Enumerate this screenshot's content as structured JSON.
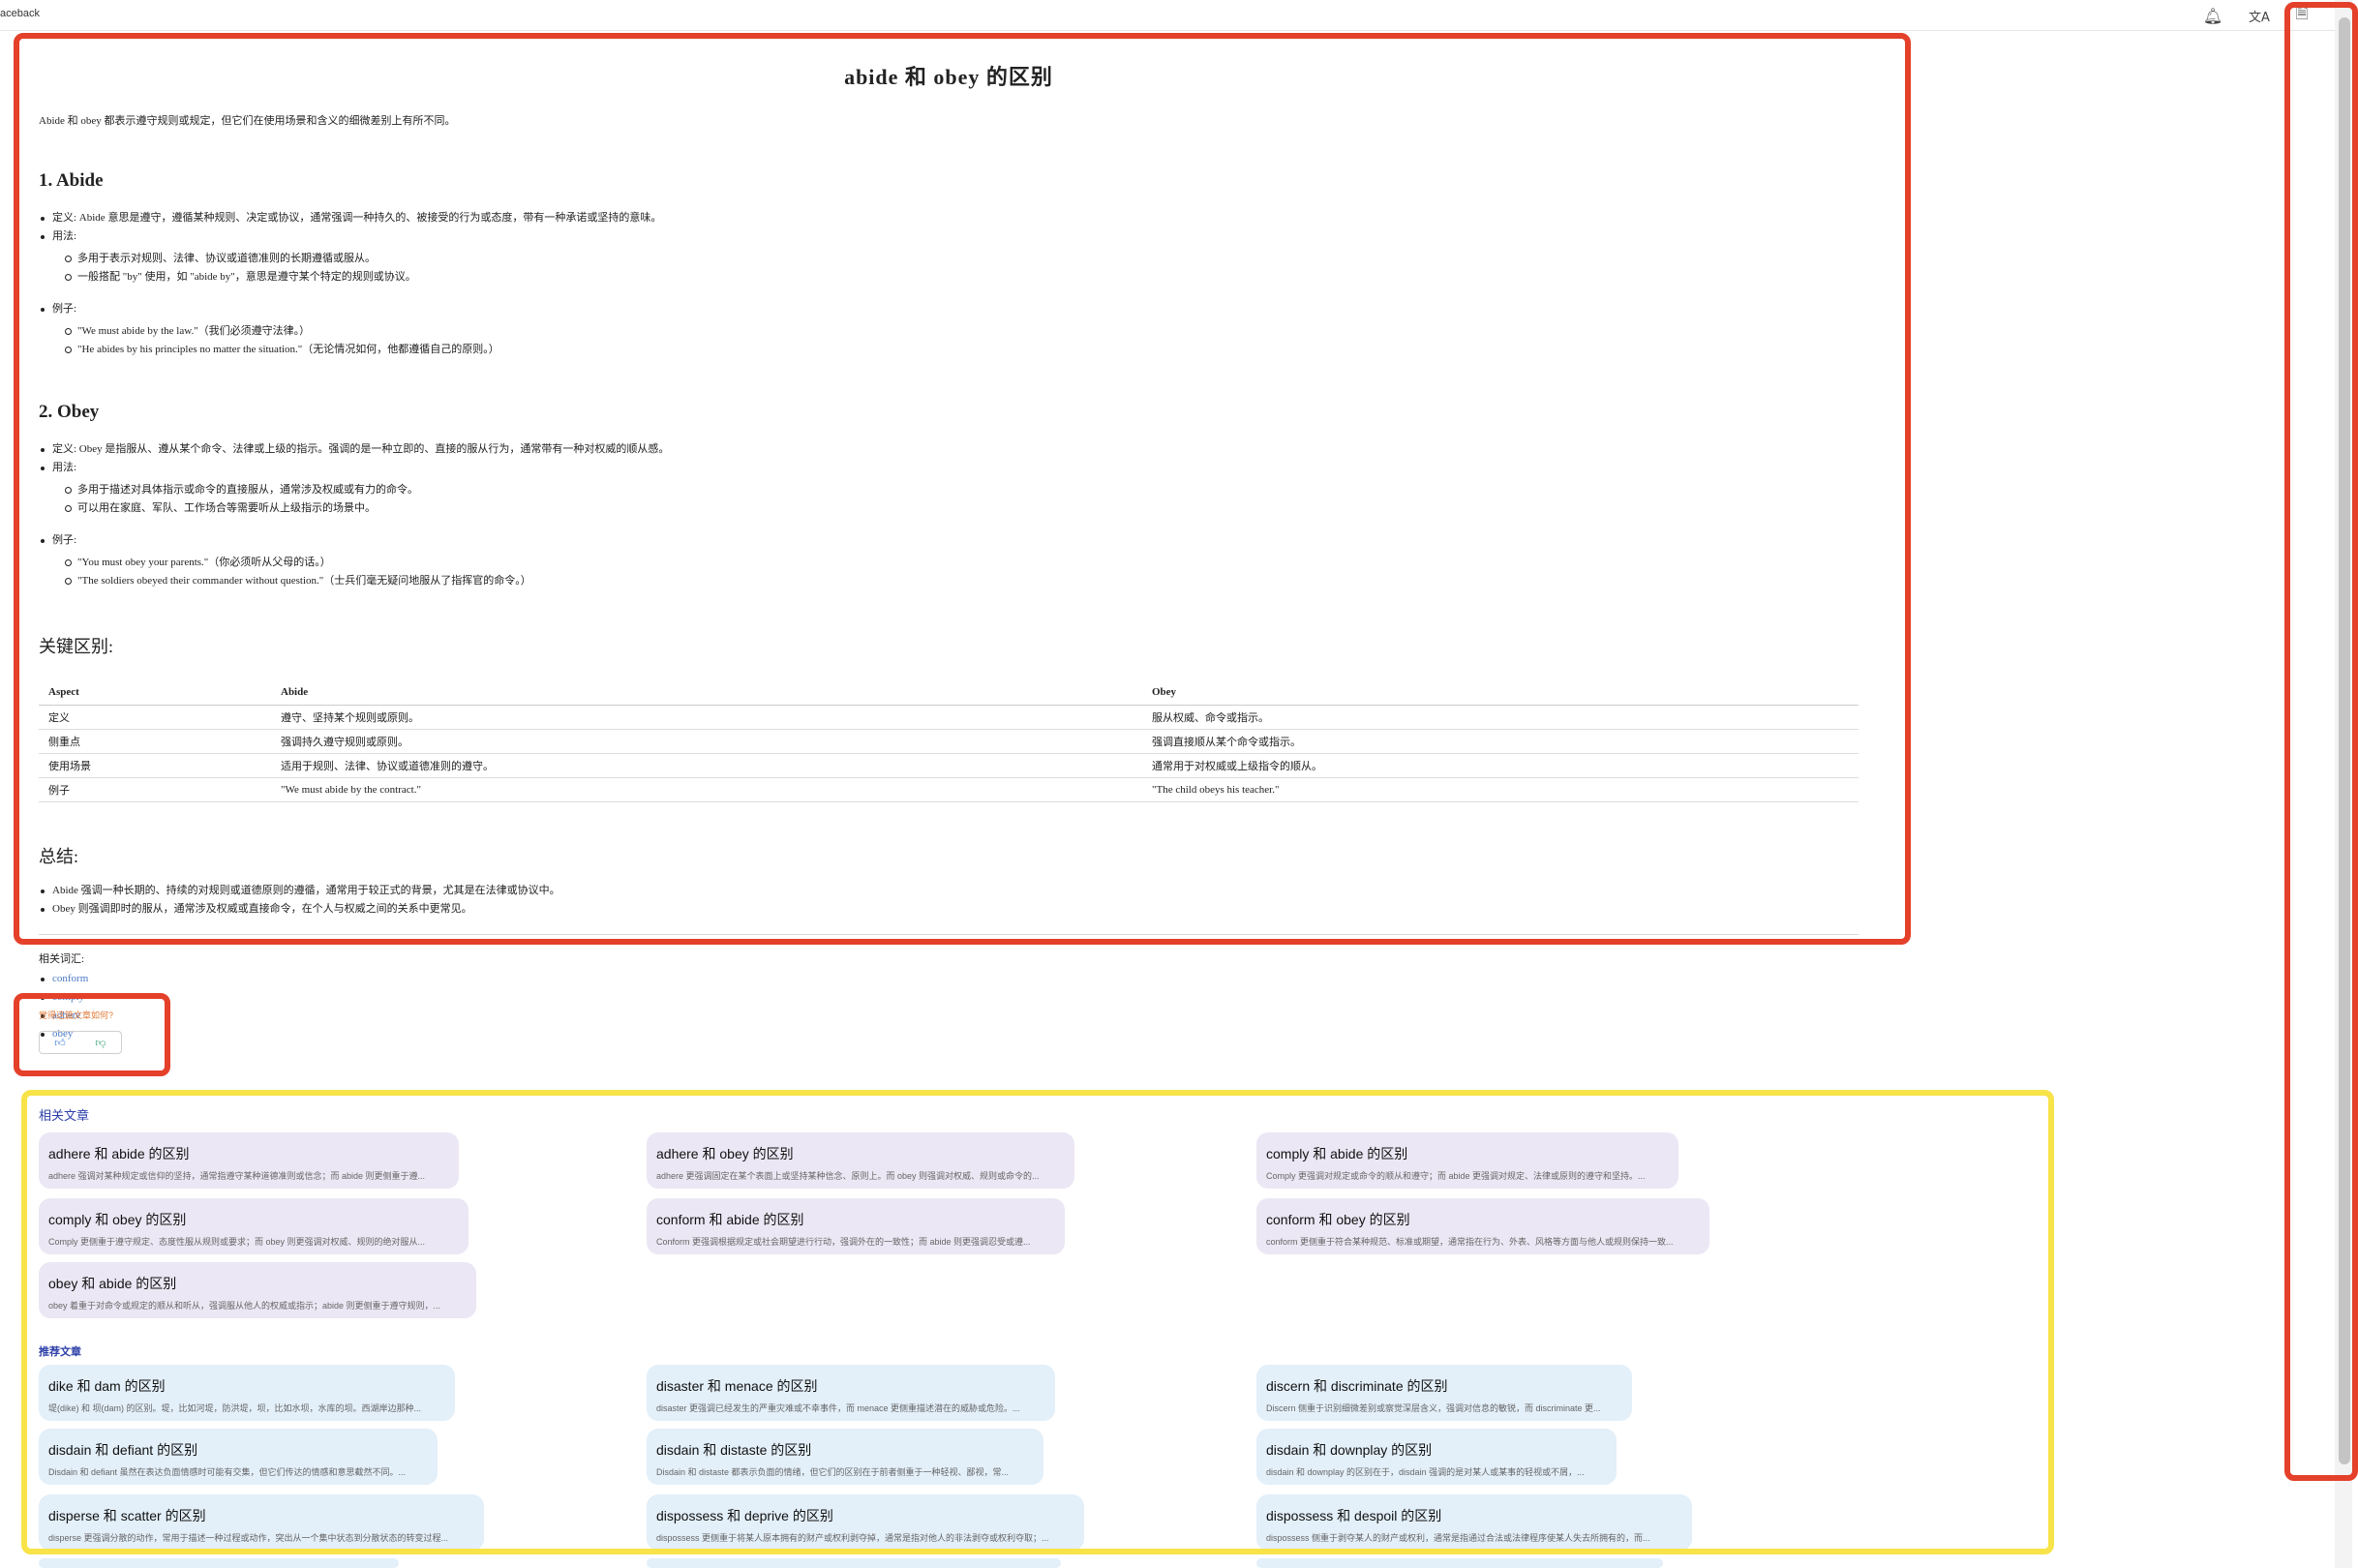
{
  "topbar": {
    "brand": "aceback",
    "icons": [
      "bell-icon",
      "translate-icon",
      "document-icon"
    ]
  },
  "article": {
    "title": "abide 和 obey 的区别",
    "intro": "Abide 和 obey 都表示遵守规则或规定，但它们在使用场景和含义的细微差别上有所不同。",
    "s1": {
      "heading": "1. Abide",
      "def": "定义: Abide 意思是遵守，遵循某种规则、决定或协议，通常强调一种持久的、被接受的行为或态度，带有一种承诺或坚持的意味。",
      "usage_label": "用法:",
      "usage": [
        "多用于表示对规则、法律、协议或道德准则的长期遵循或服从。",
        "一般搭配 \"by\" 使用，如 \"abide by\"，意思是遵守某个特定的规则或协议。"
      ],
      "ex_label": "例子:",
      "examples": [
        "\"We must abide by the law.\"（我们必须遵守法律。）",
        "\"He abides by his principles no matter the situation.\"（无论情况如何，他都遵循自己的原则。）"
      ]
    },
    "s2": {
      "heading": "2. Obey",
      "def": "定义: Obey 是指服从、遵从某个命令、法律或上级的指示。强调的是一种立即的、直接的服从行为，通常带有一种对权威的顺从感。",
      "usage_label": "用法:",
      "usage": [
        "多用于描述对具体指示或命令的直接服从，通常涉及权威或有力的命令。",
        "可以用在家庭、军队、工作场合等需要听从上级指示的场景中。"
      ],
      "ex_label": "例子:",
      "examples": [
        "\"You must obey your parents.\"（你必须听从父母的话。）",
        "\"The soldiers obeyed their commander without question.\"（士兵们毫无疑问地服从了指挥官的命令。）"
      ]
    },
    "diff_heading": "关键区别:",
    "table": {
      "headers": [
        "Aspect",
        "Abide",
        "Obey"
      ],
      "rows": [
        [
          "定义",
          "遵守、坚持某个规则或原则。",
          "服从权威、命令或指示。"
        ],
        [
          "侧重点",
          "强调持久遵守规则或原则。",
          "强调直接顺从某个命令或指示。"
        ],
        [
          "使用场景",
          "适用于规则、法律、协议或道德准则的遵守。",
          "通常用于对权威或上级指令的顺从。"
        ],
        [
          "例子",
          "\"We must abide by the contract.\"",
          "\"The child obeys his teacher.\""
        ]
      ]
    },
    "summary_heading": "总结:",
    "summary": [
      "Abide 强调一种长期的、持续的对规则或道德原则的遵循，通常用于较正式的背景，尤其是在法律或协议中。",
      "Obey 则强调即时的服从，通常涉及权威或直接命令，在个人与权威之间的关系中更常见。"
    ],
    "related_label": "相关词汇:",
    "related_words": [
      "conform",
      "comply",
      "adhere",
      "obey"
    ]
  },
  "feedback": {
    "question": "觉得这篇文章如何?",
    "up_icon": "thumbs-up-icon",
    "down_icon": "thumbs-down-icon"
  },
  "related_articles": {
    "heading": "相关文章",
    "cards": [
      {
        "title": "adhere 和 abide 的区别",
        "desc": "adhere 强调对某种规定或信仰的坚持，通常指遵守某种道德准则或信念；而 abide 则更侧重于遵..."
      },
      {
        "title": "adhere 和 obey 的区别",
        "desc": "adhere 更强调固定在某个表面上或坚持某种信念、原则上。而 obey 则强调对权威、规则或命令的..."
      },
      {
        "title": "comply 和 abide 的区别",
        "desc": "Comply 更强调对规定或命令的顺从和遵守；而 abide 更强调对规定、法律或原则的遵守和坚持。..."
      },
      {
        "title": "comply 和 obey 的区别",
        "desc": "Comply 更侧重于遵守规定、态度性服从规则或要求；而 obey 则更强调对权威、规则的绝对服从..."
      },
      {
        "title": "conform 和 abide 的区别",
        "desc": "Conform 更强调根据规定或社会期望进行行动，强调外在的一致性；而 abide 则更强调忍受或遵..."
      },
      {
        "title": "conform 和 obey 的区别",
        "desc": "conform 更侧重于符合某种规范、标准或期望，通常指在行为、外表、风格等方面与他人或规则保持一致..."
      },
      {
        "title": "obey 和 abide 的区别",
        "desc": "obey 着重于对命令或规定的顺从和听从，强调服从他人的权威或指示；abide 则更侧重于遵守规则，..."
      }
    ]
  },
  "recommended_articles": {
    "heading": "推荐文章",
    "cards": [
      {
        "title": "dike 和 dam 的区别",
        "desc": "堤(dike) 和 坝(dam) 的区别。堤，比如河堤，防洪堤，坝，比如水坝，水库的坝。西湖岸边那种..."
      },
      {
        "title": "disaster 和 menace 的区别",
        "desc": "disaster 更强调已经发生的严重灾难或不幸事件，而 menace 更侧重描述潜在的威胁或危险。..."
      },
      {
        "title": "discern 和 discriminate 的区别",
        "desc": "Discern 侧重于识别细微差别或察觉深层含义，强调对信息的敏锐，而 discriminate 更..."
      },
      {
        "title": "disdain 和 defiant 的区别",
        "desc": "Disdain 和 defiant 虽然在表达负面情感时可能有交集，但它们传达的情感和意思截然不同。..."
      },
      {
        "title": "disdain 和 distaste 的区别",
        "desc": "Disdain 和 distaste 都表示负面的情绪，但它们的区别在于前者侧重于一种轻视、鄙视，常..."
      },
      {
        "title": "disdain 和 downplay 的区别",
        "desc": "disdain 和 downplay 的区别在于，disdain 强调的是对某人或某事的轻视或不屑，..."
      },
      {
        "title": "disperse 和 scatter 的区别",
        "desc": "disperse 更强调分散的动作，常用于描述一种过程或动作，突出从一个集中状态到分散状态的转变过程..."
      },
      {
        "title": "dispossess 和 deprive 的区别",
        "desc": "dispossess 更侧重于将某人原本拥有的财产或权利剥夺掉，通常是指对他人的非法剥夺或权利夺取；..."
      },
      {
        "title": "dispossess 和 despoil 的区别",
        "desc": "dispossess 侧重于剥夺某人的财产或权利，通常是指通过合法或法律程序使某人失去所拥有的，而..."
      }
    ]
  },
  "colors": {
    "highlight_red": "#e4402a",
    "highlight_yellow": "#f8e348",
    "related_card_bg": "#ece7f4",
    "recommended_card_bg": "#e3eff9",
    "section_heading": "#2c3fa8",
    "link": "#4a78c2"
  }
}
